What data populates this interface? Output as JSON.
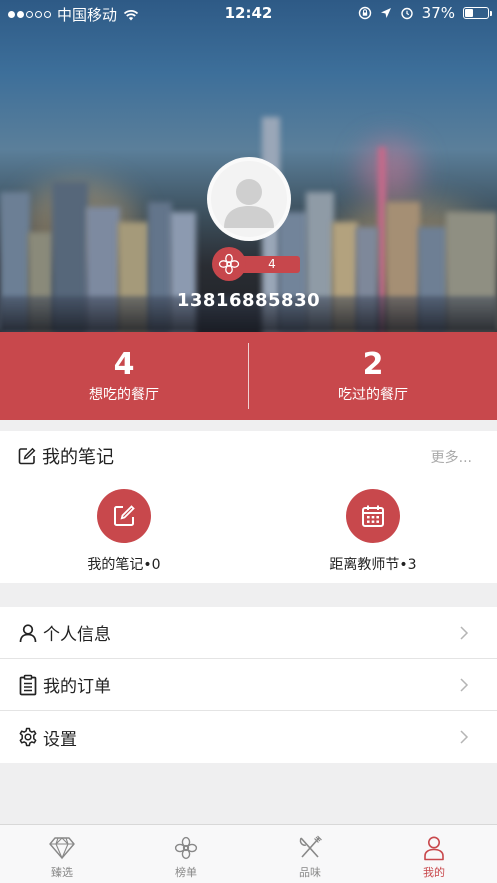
{
  "status_bar": {
    "carrier": "中国移动",
    "time": "12:42",
    "battery": "37%",
    "battery_level": 0.37
  },
  "profile": {
    "level": "4",
    "phone": "13816885830"
  },
  "stats": [
    {
      "value": "4",
      "label": "想吃的餐厅"
    },
    {
      "value": "2",
      "label": "吃过的餐厅"
    }
  ],
  "notes": {
    "title": "我的笔记",
    "more": "更多...",
    "items": [
      {
        "label": "我的笔记•0",
        "icon": "edit-icon"
      },
      {
        "label": "距离教师节•3",
        "icon": "calendar-icon"
      }
    ]
  },
  "menu": [
    {
      "label": "个人信息",
      "icon": "person-icon"
    },
    {
      "label": "我的订单",
      "icon": "clipboard-icon"
    },
    {
      "label": "设置",
      "icon": "gear-icon"
    }
  ],
  "tabs": [
    {
      "label": "臻选",
      "icon": "diamond-icon"
    },
    {
      "label": "榜单",
      "icon": "flower-icon"
    },
    {
      "label": "品味",
      "icon": "utensils-icon"
    },
    {
      "label": "我的",
      "icon": "person-icon",
      "active": true
    }
  ],
  "colors": {
    "brand": "#c8484c",
    "inactive_tab": "#888888"
  }
}
